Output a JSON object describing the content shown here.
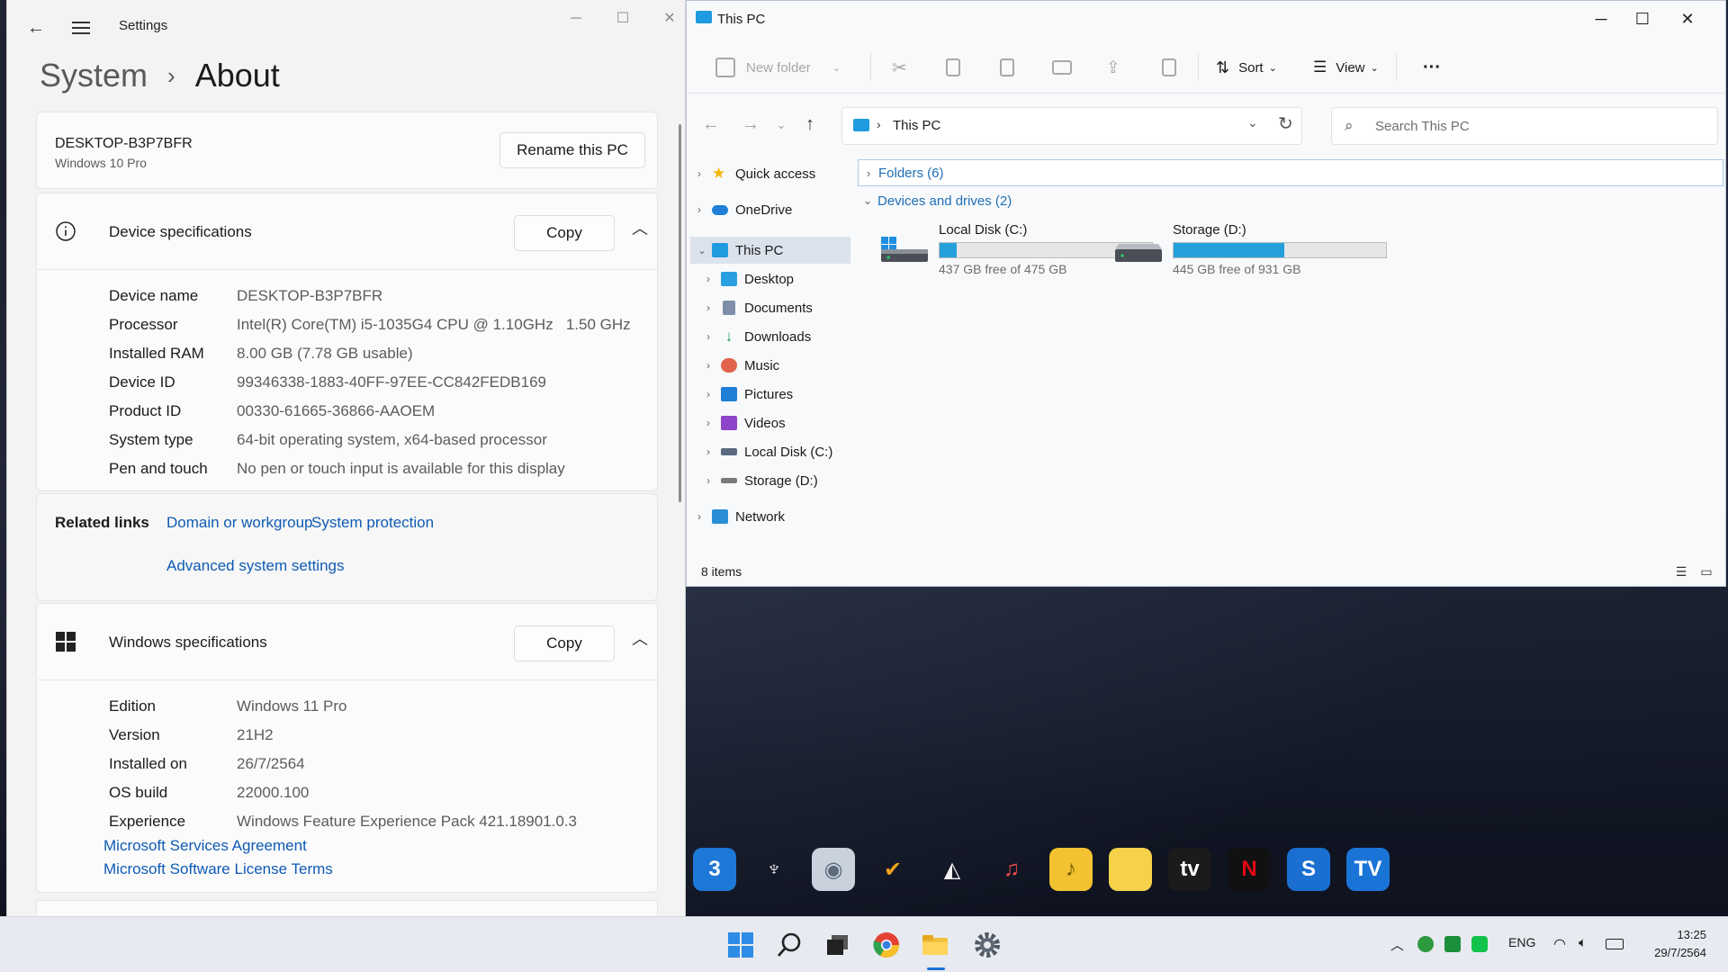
{
  "settings": {
    "app_name": "Settings",
    "breadcrumb": {
      "parent": "System",
      "separator": "›",
      "current": "About"
    },
    "pc": {
      "name": "DESKTOP-B3P7BFR",
      "os": "Windows 10 Pro",
      "rename_label": "Rename this PC"
    },
    "device_specs": {
      "title": "Device specifications",
      "copy_label": "Copy",
      "rows": [
        {
          "k": "Device name",
          "v": "DESKTOP-B3P7BFR"
        },
        {
          "k": "Processor",
          "v": "Intel(R) Core(TM) i5-1035G4 CPU @ 1.10GHz   1.50 GHz"
        },
        {
          "k": "Installed RAM",
          "v": "8.00 GB (7.78 GB usable)"
        },
        {
          "k": "Device ID",
          "v": "99346338-1883-40FF-97EE-CC842FEDB169"
        },
        {
          "k": "Product ID",
          "v": "00330-61665-36866-AAOEM"
        },
        {
          "k": "System type",
          "v": "64-bit operating system, x64-based processor"
        },
        {
          "k": "Pen and touch",
          "v": "No pen or touch input is available for this display"
        }
      ]
    },
    "related": {
      "label": "Related links",
      "links": [
        "Domain or workgroup",
        "System protection",
        "Advanced system settings"
      ]
    },
    "windows_specs": {
      "title": "Windows specifications",
      "copy_label": "Copy",
      "rows": [
        {
          "k": "Edition",
          "v": "Windows 11 Pro"
        },
        {
          "k": "Version",
          "v": "21H2"
        },
        {
          "k": "Installed on",
          "v": "26/7/2564"
        },
        {
          "k": "OS build",
          "v": "22000.100"
        },
        {
          "k": "Experience",
          "v": "Windows Feature Experience Pack 421.18901.0.3"
        }
      ],
      "links": [
        "Microsoft Services Agreement",
        "Microsoft Software License Terms"
      ]
    }
  },
  "explorer": {
    "title": "This PC",
    "commands": {
      "new_folder": "New folder",
      "sort": "Sort",
      "view": "View",
      "more": "···"
    },
    "address": {
      "path": "This PC"
    },
    "search": {
      "placeholder": "Search This PC"
    },
    "nav": [
      {
        "label": "Quick access",
        "icon": "star-icon",
        "color": "#f2b705"
      },
      {
        "label": "OneDrive",
        "icon": "cloud-icon",
        "color": "#1f7fd6"
      },
      {
        "label": "This PC",
        "icon": "computer-icon",
        "color": "#1f9be0"
      },
      {
        "label": "Desktop",
        "icon": "desktop-folder-icon",
        "color": "#2a9fe0"
      },
      {
        "label": "Documents",
        "icon": "documents-icon",
        "color": "#7e8ea8"
      },
      {
        "label": "Downloads",
        "icon": "downloads-icon",
        "color": "#1fa05a"
      },
      {
        "label": "Music",
        "icon": "music-icon",
        "color": "#e0634e"
      },
      {
        "label": "Pictures",
        "icon": "pictures-icon",
        "color": "#1f7fd6"
      },
      {
        "label": "Videos",
        "icon": "videos-icon",
        "color": "#8e44c8"
      },
      {
        "label": "Local Disk (C:)",
        "icon": "drive-icon",
        "color": "#5a6b80"
      },
      {
        "label": "Storage (D:)",
        "icon": "drive-icon",
        "color": "#7a7a7a"
      },
      {
        "label": "Network",
        "icon": "network-icon",
        "color": "#2a8ed6"
      }
    ],
    "groups": {
      "folders": "Folders (6)",
      "devices": "Devices and drives (2)"
    },
    "drives": [
      {
        "name": "Local Disk (C:)",
        "free_text": "437 GB free of 475 GB",
        "used_fraction": 0.08
      },
      {
        "name": "Storage (D:)",
        "free_text": "445 GB free of 931 GB",
        "used_fraction": 0.52
      }
    ],
    "status": "8 items"
  },
  "desktop_apps": [
    {
      "name": "app-3-icon",
      "glyph": "3",
      "bg": "#1e78d8"
    },
    {
      "name": "podcast-icon",
      "glyph": "♆",
      "bg": "#ffffff00"
    },
    {
      "name": "disc-icon",
      "glyph": "◉",
      "bg": "#c9d2dc"
    },
    {
      "name": "checklist-icon",
      "glyph": "✔",
      "bg": "#ffffff00"
    },
    {
      "name": "fox-icon",
      "glyph": "◭",
      "bg": "#ffffff00"
    },
    {
      "name": "music-note-icon",
      "glyph": "♫",
      "bg": "#ffffff00"
    },
    {
      "name": "music-folder-icon",
      "glyph": "♪",
      "bg": "#f2c230"
    },
    {
      "name": "folder-icon",
      "glyph": "▬",
      "bg": "#f5d24a"
    },
    {
      "name": "apple-tv-icon",
      "glyph": "tv",
      "bg": "#1b1b1b"
    },
    {
      "name": "netflix-icon",
      "glyph": "N",
      "bg": "#111111"
    },
    {
      "name": "s-logo-icon",
      "glyph": "S",
      "bg": "#1a6fd0"
    },
    {
      "name": "tv-logo-icon",
      "glyph": "TV",
      "bg": "#1a74d8"
    }
  ],
  "taskbar": {
    "language": "ENG",
    "time": "13:25",
    "date": "29/7/2564"
  }
}
